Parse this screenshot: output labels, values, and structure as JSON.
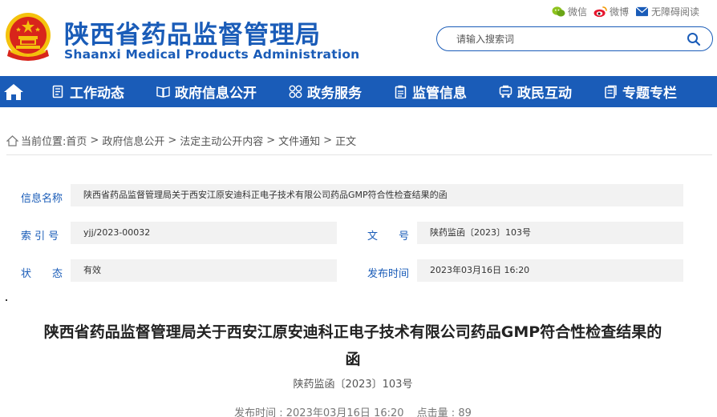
{
  "header": {
    "brand_cn": "陕西省药品监督管理局",
    "brand_en": "Shaanxi Medical Products Administration",
    "tools": [
      {
        "label": "微信",
        "icon": "wechat-icon"
      },
      {
        "label": "微博",
        "icon": "weibo-icon"
      },
      {
        "label": "无障碍阅读",
        "icon": "accessibility-icon"
      }
    ],
    "search_placeholder": "请输入搜索词"
  },
  "nav": {
    "items": [
      {
        "label": "工作动态",
        "icon": "document-list-icon"
      },
      {
        "label": "政府信息公开",
        "icon": "open-book-icon"
      },
      {
        "label": "政务服务",
        "icon": "grid-circles-icon"
      },
      {
        "label": "监管信息",
        "icon": "clipboard-icon"
      },
      {
        "label": "政民互动",
        "icon": "chat-network-icon"
      },
      {
        "label": "专题专栏",
        "icon": "notes-icon"
      }
    ]
  },
  "breadcrumb": {
    "prefix": "当前位置:",
    "items": [
      "首页",
      "政府信息公开",
      "法定主动公开内容",
      "文件通知",
      "正文"
    ],
    "separator": ">"
  },
  "info": {
    "name_label": "信息名称",
    "name_value": "陕西省药品监督管理局关于西安江原安迪科正电子技术有限公司药品GMP符合性检查结果的函",
    "index_label": "索 引 号",
    "index_value": "yjj/2023-00032",
    "docno_label": "文　　号",
    "docno_value": "陕药监函〔2023〕103号",
    "status_label": "状　　态",
    "status_value": "有效",
    "date_label": "发布时间",
    "date_value": "2023年03月16日 16:20"
  },
  "article": {
    "title_line1": "陕西省药品监督管理局关于西安江原安迪科正电子技术有限公司药品GMP符合性检查结果的",
    "title_line2": "函",
    "docno": "陕药监函〔2023〕103号",
    "publish_label": "发布时间 : ",
    "publish_value": "2023年03月16日 16:20",
    "clicks_label": "点击量 : ",
    "clicks_value": "89"
  },
  "colors": {
    "brand_blue": "#1a5cb8",
    "field_bg": "#f2f2f2",
    "emblem_red": "#d8251b",
    "emblem_gold": "#f4c20d"
  }
}
